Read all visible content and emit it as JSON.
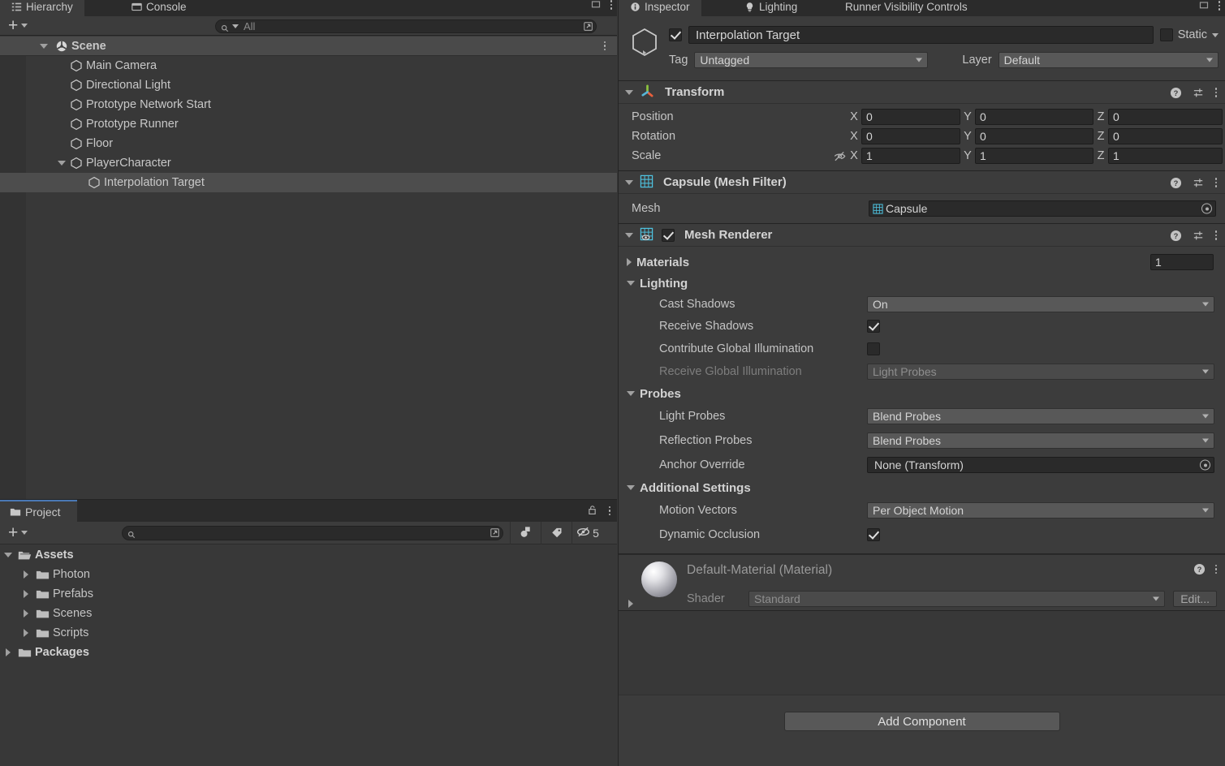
{
  "hierarchy": {
    "tabs": [
      {
        "label": "Hierarchy",
        "icon": "hierarchy-icon",
        "active": true
      },
      {
        "label": "Console",
        "icon": "console-icon",
        "active": false
      }
    ],
    "create_button_label": "+",
    "search": {
      "placeholder": "All",
      "value": ""
    },
    "rows": [
      {
        "label": "Scene",
        "depth": 0,
        "expanded": true,
        "icon": "unity-scene-icon",
        "selected": false,
        "is_scene": true
      },
      {
        "label": "Main Camera",
        "depth": 1,
        "expanded": null,
        "icon": "gameobject-icon",
        "selected": false
      },
      {
        "label": "Directional Light",
        "depth": 1,
        "expanded": null,
        "icon": "gameobject-icon",
        "selected": false
      },
      {
        "label": "Prototype Network Start",
        "depth": 1,
        "expanded": null,
        "icon": "gameobject-icon",
        "selected": false
      },
      {
        "label": "Prototype Runner",
        "depth": 1,
        "expanded": null,
        "icon": "gameobject-icon",
        "selected": false
      },
      {
        "label": "Floor",
        "depth": 1,
        "expanded": null,
        "icon": "gameobject-icon",
        "selected": false
      },
      {
        "label": "PlayerCharacter",
        "depth": 1,
        "expanded": true,
        "icon": "gameobject-icon",
        "selected": false
      },
      {
        "label": "Interpolation Target",
        "depth": 2,
        "expanded": null,
        "icon": "gameobject-icon",
        "selected": true
      }
    ]
  },
  "project": {
    "tab_label": "Project",
    "create_button_label": "+",
    "search": {
      "placeholder": "",
      "value": ""
    },
    "hidden_count": "5",
    "rows": [
      {
        "label": "Assets",
        "depth": 0,
        "expanded": true,
        "bold": true
      },
      {
        "label": "Photon",
        "depth": 1,
        "expanded": false,
        "bold": false
      },
      {
        "label": "Prefabs",
        "depth": 1,
        "expanded": false,
        "bold": false
      },
      {
        "label": "Scenes",
        "depth": 1,
        "expanded": false,
        "bold": false
      },
      {
        "label": "Scripts",
        "depth": 1,
        "expanded": false,
        "bold": false
      },
      {
        "label": "Packages",
        "depth": 0,
        "expanded": false,
        "bold": true
      }
    ]
  },
  "inspector": {
    "tabs": [
      {
        "label": "Inspector",
        "icon": "inspector-icon",
        "active": true
      },
      {
        "label": "Lighting",
        "icon": "lighting-icon",
        "active": false
      },
      {
        "label": "Runner Visibility Controls",
        "icon": "",
        "active": false
      }
    ],
    "object": {
      "enabled": true,
      "name": "Interpolation Target",
      "static_label": "Static",
      "static_checked": false,
      "tag_label": "Tag",
      "tag_value": "Untagged",
      "layer_label": "Layer",
      "layer_value": "Default"
    },
    "transform": {
      "title": "Transform",
      "expanded": true,
      "rows": [
        {
          "label": "Position",
          "x": "0",
          "y": "0",
          "z": "0"
        },
        {
          "label": "Rotation",
          "x": "0",
          "y": "0",
          "z": "0"
        },
        {
          "label": "Scale",
          "x": "1",
          "y": "1",
          "z": "1"
        }
      ],
      "axis_labels": {
        "x": "X",
        "y": "Y",
        "z": "Z"
      }
    },
    "mesh_filter": {
      "title": "Capsule (Mesh Filter)",
      "expanded": true,
      "mesh_label": "Mesh",
      "mesh_value": "Capsule"
    },
    "mesh_renderer": {
      "title": "Mesh Renderer",
      "expanded": true,
      "enabled": true,
      "materials_label": "Materials",
      "materials_count": "1",
      "lighting_label": "Lighting",
      "cast_shadows_label": "Cast Shadows",
      "cast_shadows_value": "On",
      "receive_shadows_label": "Receive Shadows",
      "receive_shadows_checked": true,
      "contribute_gi_label": "Contribute Global Illumination",
      "contribute_gi_checked": false,
      "receive_gi_label": "Receive Global Illumination",
      "receive_gi_value": "Light Probes",
      "probes_label": "Probes",
      "light_probes_label": "Light Probes",
      "light_probes_value": "Blend Probes",
      "reflection_probes_label": "Reflection Probes",
      "reflection_probes_value": "Blend Probes",
      "anchor_override_label": "Anchor Override",
      "anchor_override_value": "None (Transform)",
      "additional_settings_label": "Additional Settings",
      "motion_vectors_label": "Motion Vectors",
      "motion_vectors_value": "Per Object Motion",
      "dynamic_occlusion_label": "Dynamic Occlusion",
      "dynamic_occlusion_checked": true
    },
    "material": {
      "title": "Default-Material (Material)",
      "shader_label": "Shader",
      "shader_value": "Standard",
      "edit_label": "Edit..."
    },
    "add_component_label": "Add Component"
  },
  "colors": {
    "panel_bg": "#383838",
    "component_bg": "#3c3c3c",
    "tabbar_bg": "#2b2b2b",
    "field_bg": "#2a2a2a",
    "dropdown_bg": "#585858",
    "selection": "#4d4d4d",
    "accent_blue": "#4a78b4",
    "mesh_icon_cyan": "#4ec3e0",
    "text": "#c4c4c4"
  }
}
